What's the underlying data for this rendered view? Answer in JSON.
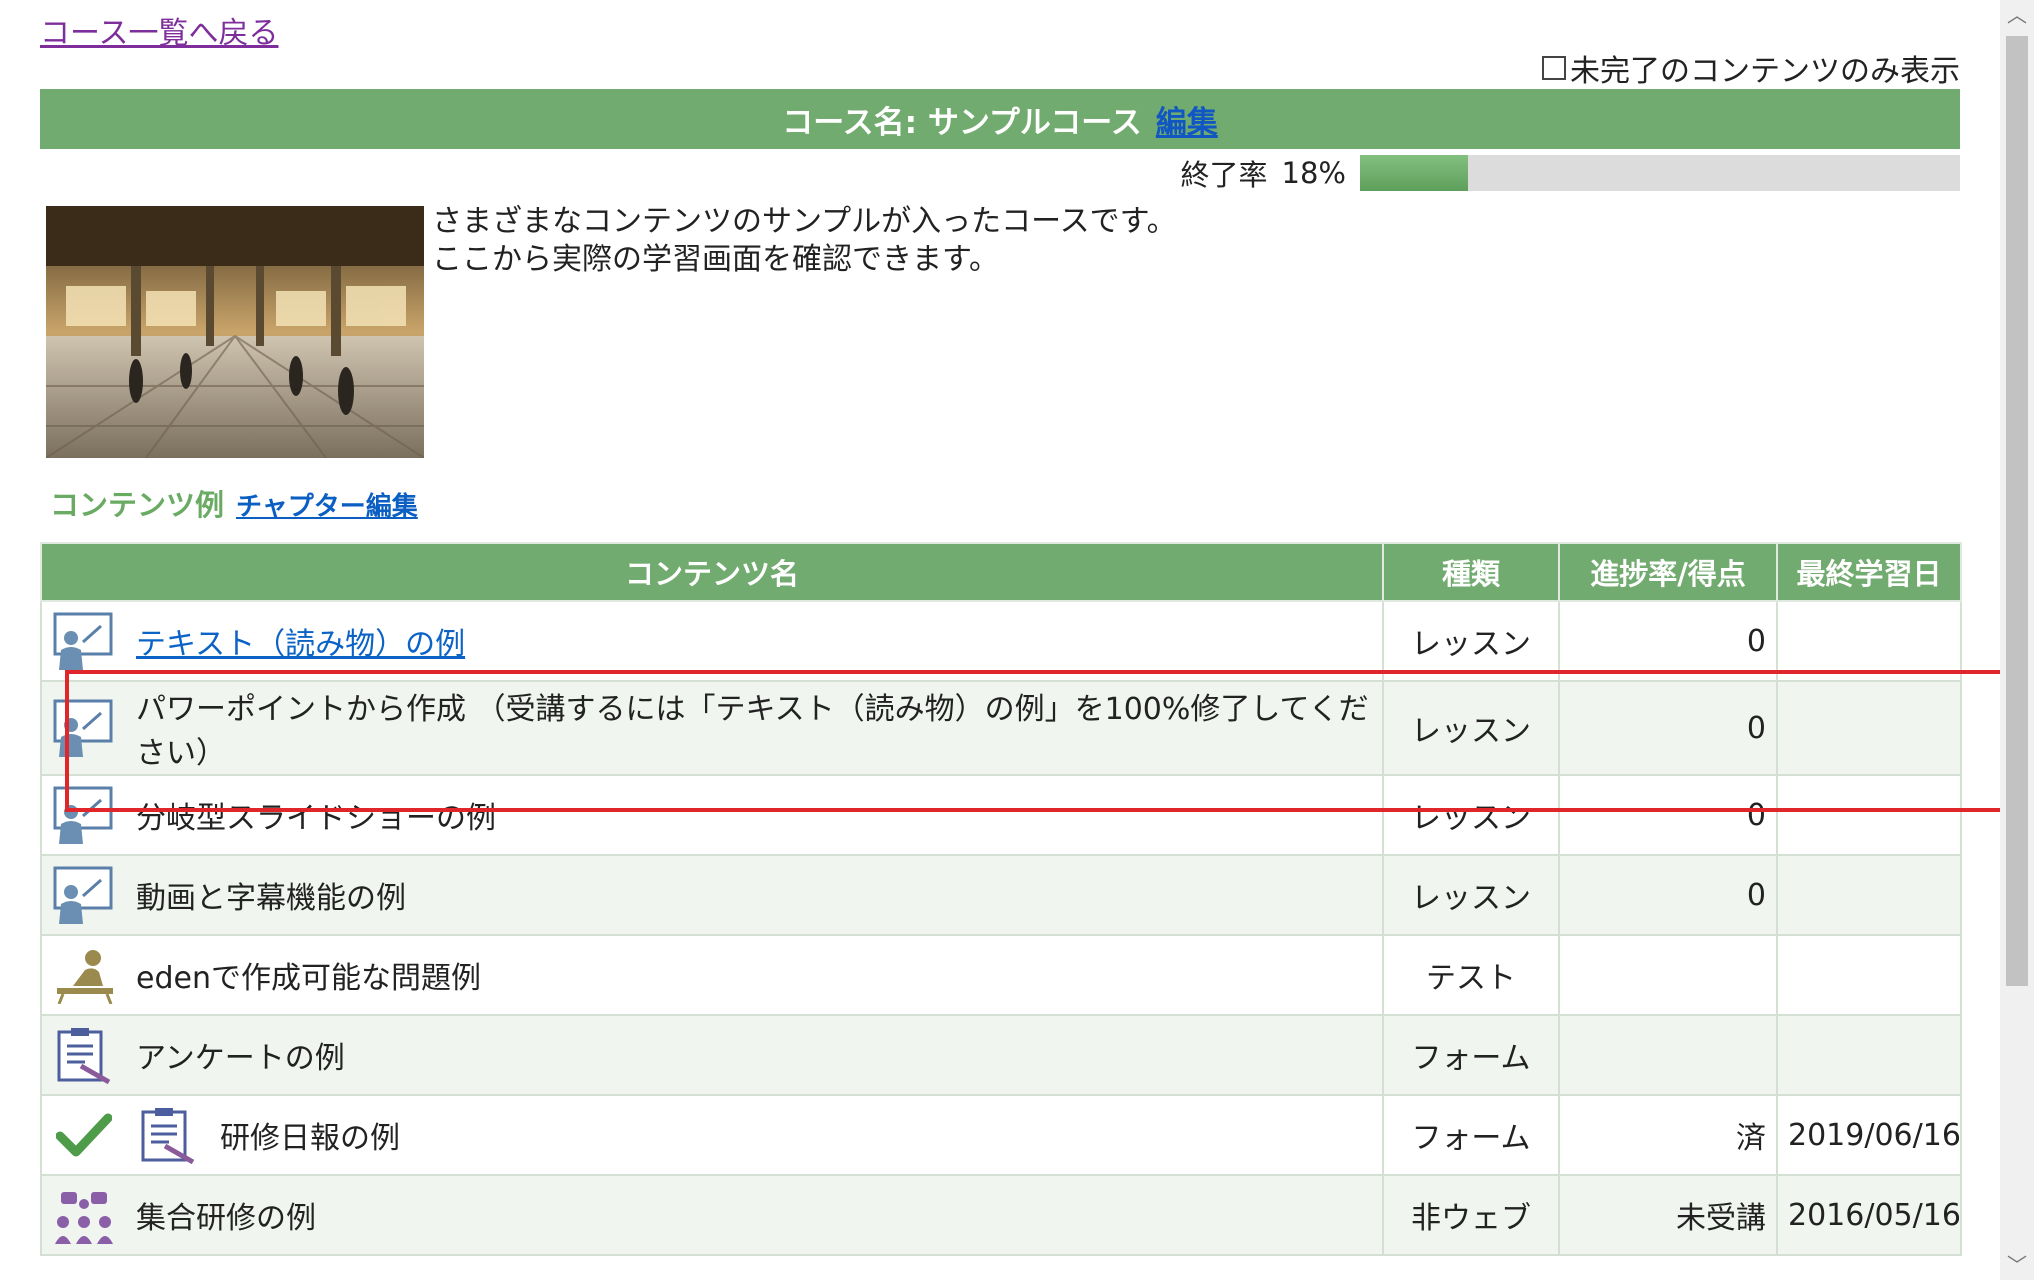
{
  "back_link": "コース一覧へ戻る",
  "filter": {
    "label": "未完了のコンテンツのみ表示",
    "checked": false
  },
  "course": {
    "title": "コース名: サンプルコース",
    "edit_label": "編集"
  },
  "progress": {
    "label": "終了率",
    "value_text": "18%",
    "fraction": 0.18
  },
  "description": [
    "さまざまなコンテンツのサンプルが入ったコースです。",
    "ここから実際の学習画面を確認できます。"
  ],
  "section": {
    "title": "コンテンツ例",
    "edit_label": "チャプター編集"
  },
  "table": {
    "headers": [
      "コンテンツ名",
      "種類",
      "進捗率/得点",
      "最終学習日"
    ],
    "rows": [
      {
        "icon": "lecture-icon",
        "name": "テキスト（読み物）の例",
        "link": true,
        "type": "レッスン",
        "score": "0",
        "date": ""
      },
      {
        "icon": "lecture-icon",
        "name": "パワーポイントから作成 （受講するには「テキスト（読み物）の例」を100%修了してください）",
        "link": false,
        "type": "レッスン",
        "score": "0",
        "date": ""
      },
      {
        "icon": "lecture-icon",
        "name": "分岐型スライドショーの例",
        "link": false,
        "type": "レッスン",
        "score": "0",
        "date": ""
      },
      {
        "icon": "lecture-icon",
        "name": "動画と字幕機能の例",
        "link": false,
        "type": "レッスン",
        "score": "0",
        "date": ""
      },
      {
        "icon": "test-icon",
        "name": "edenで作成可能な問題例",
        "link": false,
        "type": "テスト",
        "score": "",
        "date": ""
      },
      {
        "icon": "form-icon",
        "name": "アンケートの例",
        "link": false,
        "type": "フォーム",
        "score": "",
        "date": ""
      },
      {
        "icon": "form-icon",
        "check": true,
        "name": "研修日報の例",
        "link": false,
        "type": "フォーム",
        "score": "済",
        "date": "2019/06/16"
      },
      {
        "icon": "group-training-icon",
        "name": "集合研修の例",
        "link": false,
        "type": "非ウェブ",
        "score": "未受講",
        "date": "2016/05/16"
      }
    ]
  },
  "colors": {
    "header_green": "#72ab6f",
    "link_blue": "#0b63c6",
    "highlight_red": "#e0262b"
  }
}
